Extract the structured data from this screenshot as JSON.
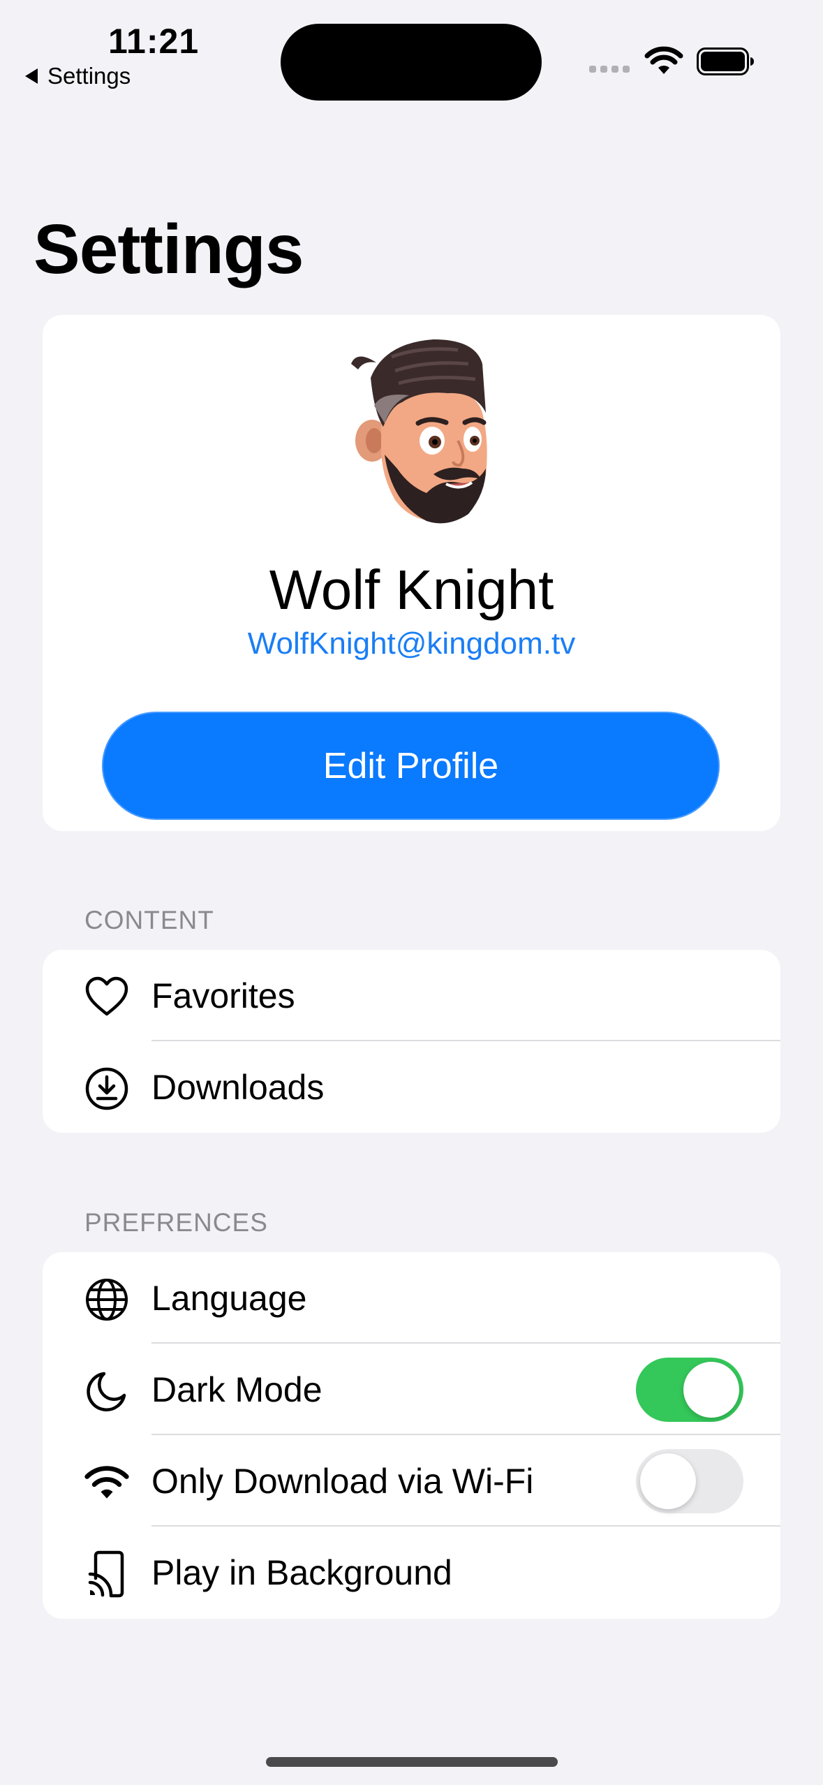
{
  "status_bar": {
    "time": "11:21",
    "back_label": "Settings"
  },
  "page": {
    "title": "Settings"
  },
  "profile": {
    "name": "Wolf Knight",
    "email": "WolfKnight@kingdom.tv",
    "edit_button": "Edit Profile"
  },
  "content_section": {
    "header": "CONTENT",
    "items": [
      {
        "label": "Favorites",
        "icon": "heart-icon"
      },
      {
        "label": "Downloads",
        "icon": "download-circle-icon"
      }
    ]
  },
  "preferences_section": {
    "header": "PREFRENCES",
    "items": [
      {
        "label": "Language",
        "icon": "globe-icon"
      },
      {
        "label": "Dark Mode",
        "icon": "moon-icon",
        "toggle": true
      },
      {
        "label": "Only Download via Wi-Fi",
        "icon": "wifi-icon",
        "toggle": false
      },
      {
        "label": "Play in Background",
        "icon": "airplay-icon"
      }
    ]
  },
  "colors": {
    "accent": "#0a7aff",
    "toggle_on": "#34c759",
    "toggle_off": "#e9e9eb",
    "background": "#f2f2f7"
  }
}
